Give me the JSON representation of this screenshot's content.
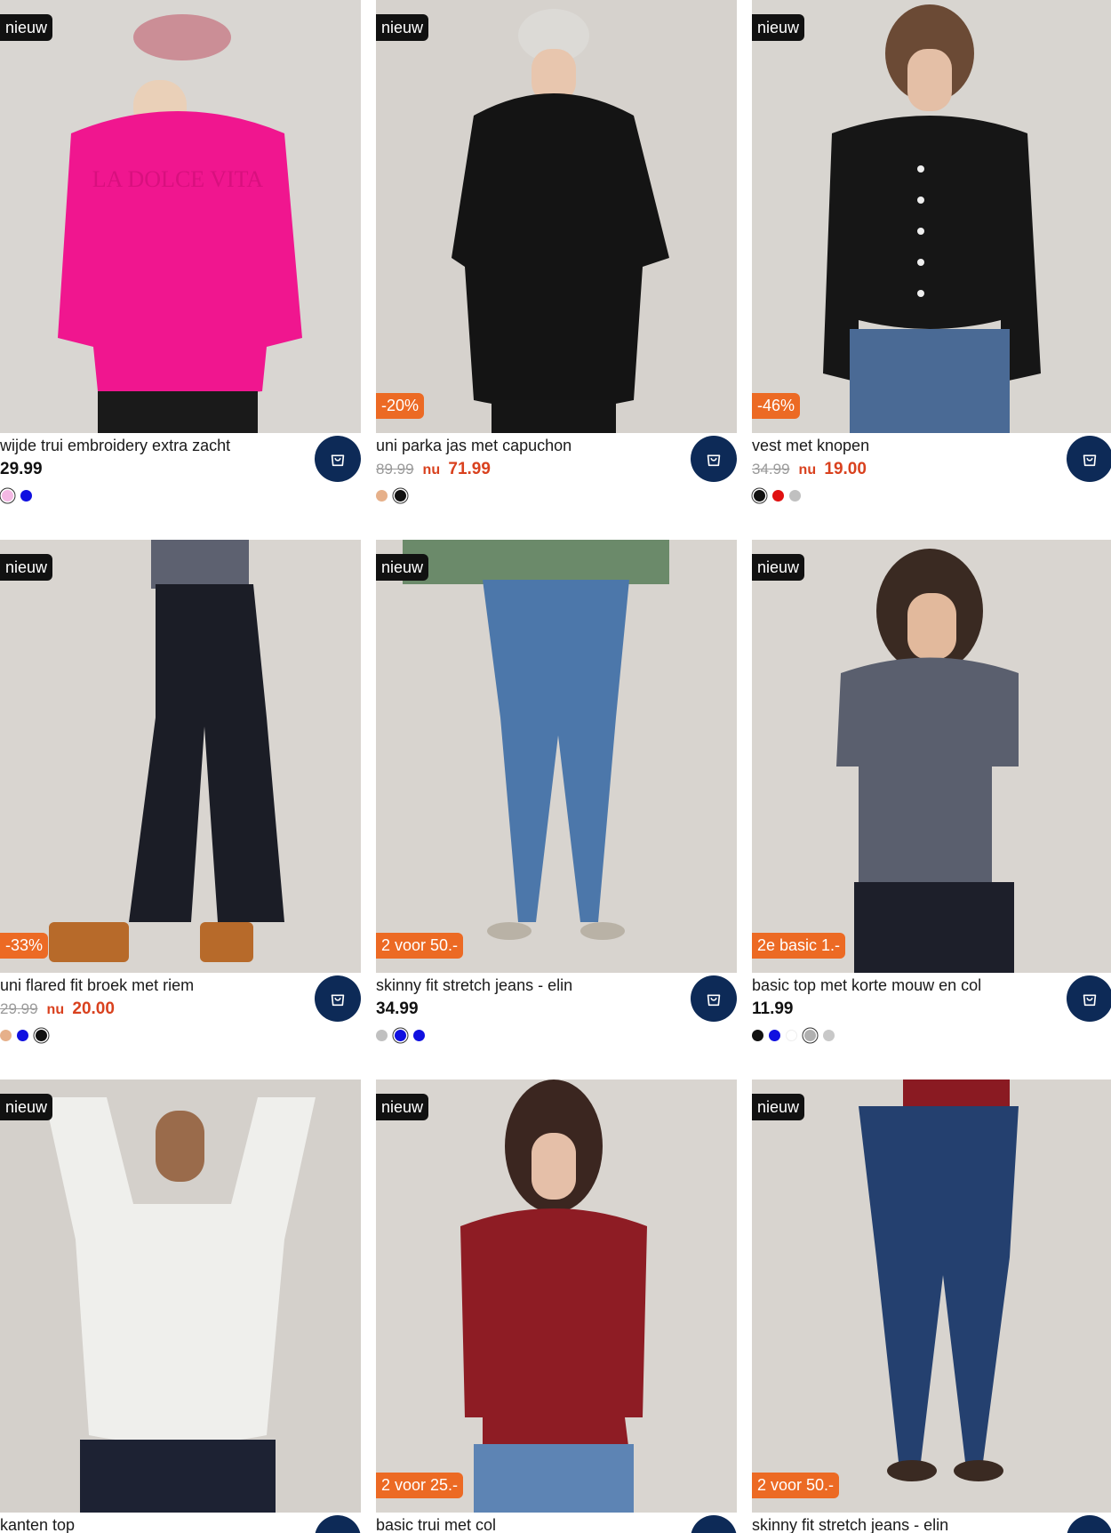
{
  "products": [
    {
      "title": "wijde trui embroidery extra zacht",
      "new_badge": "nieuw",
      "promo_badge": "",
      "price": "29.99",
      "old_price": "",
      "nu_label": "",
      "new_price": "",
      "swatches": [
        "#f4b8e4",
        "#1010e0"
      ],
      "selected_swatch": 0,
      "bg": "#d9d6d2",
      "garment": "#f0168f",
      "image_text": "LA DOLCE VITA"
    },
    {
      "title": "uni parka jas met capuchon",
      "new_badge": "nieuw",
      "promo_badge": "-20%",
      "price": "",
      "old_price": "89.99",
      "nu_label": "nu",
      "new_price": "71.99",
      "swatches": [
        "#e6b08a",
        "#111111"
      ],
      "selected_swatch": 1,
      "bg": "#d6d2cd",
      "garment": "#141414"
    },
    {
      "title": "vest met knopen",
      "new_badge": "nieuw",
      "promo_badge": "-46%",
      "price": "",
      "old_price": "34.99",
      "nu_label": "nu",
      "new_price": "19.00",
      "swatches": [
        "#111111",
        "#e01010",
        "#c0c0c0"
      ],
      "selected_swatch": 0,
      "bg": "#d8d5d0",
      "garment": "#161616"
    },
    {
      "title": "uni flared fit broek met riem",
      "new_badge": "nieuw",
      "promo_badge": "-33%",
      "price": "",
      "old_price": "29.99",
      "nu_label": "nu",
      "new_price": "20.00",
      "swatches": [
        "#e6b08a",
        "#1010e0",
        "#111111"
      ],
      "selected_swatch": 2,
      "bg": "#d9d5d0",
      "garment": "#1b1d26"
    },
    {
      "title": "skinny fit stretch jeans - elin",
      "new_badge": "nieuw",
      "promo_badge": "2 voor 50.-",
      "price": "34.99",
      "old_price": "",
      "nu_label": "",
      "new_price": "",
      "swatches": [
        "#c0c0c0",
        "#1010e0",
        "#1010e0"
      ],
      "selected_swatch": 1,
      "bg": "#d8d4cf",
      "garment": "#4c77aa"
    },
    {
      "title": "basic top met korte mouw en col",
      "new_badge": "nieuw",
      "promo_badge": "2e basic 1.-",
      "price": "11.99",
      "old_price": "",
      "nu_label": "",
      "new_price": "",
      "swatches": [
        "#111111",
        "#1010e0",
        "#ffffff",
        "#b0b0b0",
        "#c8c8c8"
      ],
      "selected_swatch": 3,
      "bg": "#d9d5d0",
      "garment": "#5a5f6e"
    },
    {
      "title": "kanten top",
      "new_badge": "nieuw",
      "promo_badge": "",
      "price": "",
      "old_price": "",
      "nu_label": "",
      "new_price": "",
      "swatches": [],
      "selected_swatch": -1,
      "bg": "#d4d0cb",
      "garment": "#f1f1ef"
    },
    {
      "title": "basic trui met col",
      "new_badge": "nieuw",
      "promo_badge": "2 voor 25.-",
      "price": "",
      "old_price": "",
      "nu_label": "",
      "new_price": "",
      "swatches": [],
      "selected_swatch": -1,
      "bg": "#d9d5d0",
      "garment": "#8e1c24"
    },
    {
      "title": "skinny fit stretch jeans - elin",
      "new_badge": "nieuw",
      "promo_badge": "2 voor 50.-",
      "price": "",
      "old_price": "",
      "nu_label": "",
      "new_price": "",
      "swatches": [],
      "selected_swatch": -1,
      "bg": "#d8d4cf",
      "garment": "#24406f"
    }
  ]
}
